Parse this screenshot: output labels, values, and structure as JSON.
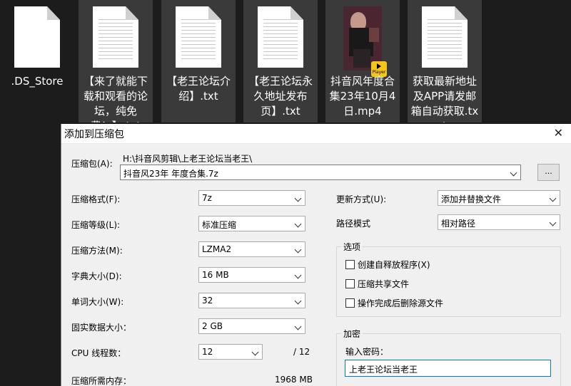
{
  "desktop": {
    "files": [
      {
        "name": ".DS_Store",
        "type": "doc-blank"
      },
      {
        "name": "【来了就能下载和观看的论坛，纯免费！】.txt",
        "type": "doc"
      },
      {
        "name": "【老王论坛介绍】.txt",
        "type": "doc"
      },
      {
        "name": "【老王论坛永久地址发布页】.txt",
        "type": "doc"
      },
      {
        "name": "抖音风年度合集23年10月4日.mp4",
        "type": "video"
      },
      {
        "name": "获取最新地址及APP请发邮箱自动获取.txt",
        "type": "doc"
      }
    ],
    "player_badge": "Player"
  },
  "dialog": {
    "title": "添加到压缩包",
    "close_glyph": "✕",
    "archive_label": "压缩包(A):",
    "archive_path": "H:\\抖音风剪辑\\上老王论坛当老王\\",
    "archive_name": "抖音风23年 年度合集.7z",
    "browse_label": "...",
    "left_fields": [
      {
        "label": "压缩格式(F):",
        "value": "7z"
      },
      {
        "label": "压缩等级(L):",
        "value": "标准压缩"
      },
      {
        "label": "压缩方法(M):",
        "value": "LZMA2"
      },
      {
        "label": "字典大小(D):",
        "value": "16 MB"
      },
      {
        "label": "单词大小(W):",
        "value": "32"
      },
      {
        "label": "固实数据大小：",
        "value": "2 GB"
      },
      {
        "label": "CPU 线程数：",
        "value": "12",
        "suffix": "/ 12"
      }
    ],
    "memory_label": "压缩所需内存：",
    "memory_value": "1968 MB",
    "update_label": "更新方式(U):",
    "update_value": "添加并替换文件",
    "path_label": "路径模式",
    "path_value": "相对路径",
    "options_title": "选项",
    "options": [
      {
        "label": "创建自释放程序(X)",
        "checked": false
      },
      {
        "label": "压缩共享文件",
        "checked": false
      },
      {
        "label": "操作完成后删除源文件",
        "checked": false
      }
    ],
    "encryption_title": "加密",
    "password_label": "输入密码：",
    "password_value": "上老王论坛当老王"
  }
}
